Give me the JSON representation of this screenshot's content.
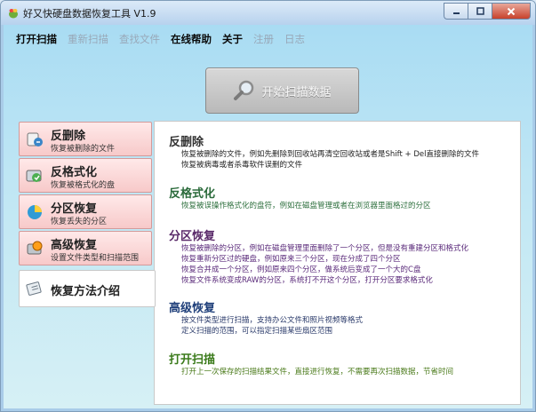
{
  "window": {
    "title": "好又快硬盘数据恢复工具 V1.9"
  },
  "menu": [
    {
      "label": "打开扫描",
      "state": "active"
    },
    {
      "label": "重新扫描",
      "state": "disabled"
    },
    {
      "label": "查找文件",
      "state": "disabled"
    },
    {
      "label": "在线帮助",
      "state": "active"
    },
    {
      "label": "关于",
      "state": "active"
    },
    {
      "label": "注册",
      "state": "disabled"
    },
    {
      "label": "日志",
      "state": "disabled"
    }
  ],
  "scan_button": {
    "label": "开始扫描数据",
    "icon": "magnifier-icon"
  },
  "sidebar": [
    {
      "title": "反删除",
      "subtitle": "恢复被删除的文件",
      "icon": "undelete-icon"
    },
    {
      "title": "反格式化",
      "subtitle": "恢复被格式化的盘",
      "icon": "unformat-icon"
    },
    {
      "title": "分区恢复",
      "subtitle": "恢复丢失的分区",
      "icon": "partition-icon"
    },
    {
      "title": "高级恢复",
      "subtitle": "设置文件类型和扫描范围",
      "icon": "advanced-icon"
    },
    {
      "title": "恢复方法介绍",
      "subtitle": "",
      "icon": "guide-icon",
      "selected": true
    }
  ],
  "content": {
    "sections": [
      {
        "title": "反删除",
        "lines": [
          "恢复被删除的文件，例如先删除到回收站再清空回收站或者是Shift + Del直接删除的文件",
          "恢复被病毒或者杀毒软件误删的文件"
        ]
      },
      {
        "title": "反格式化",
        "lines": [
          "恢复被误操作格式化的盘符，例如在磁盘管理或者在浏览器里面格过的分区"
        ]
      },
      {
        "title": "分区恢复",
        "lines": [
          "恢复被删除的分区，例如在磁盘管理里面删除了一个分区，但是没有重建分区和格式化",
          "恢复重新分区过的硬盘，例如原来三个分区，现在分成了四个分区",
          "恢复合并成一个分区，例如原来四个分区，做系统后变成了一个大的C盘",
          "恢复文件系统变成RAW的分区，系统打不开这个分区，打开分区要求格式化"
        ]
      },
      {
        "title": "高级恢复",
        "lines": [
          "按文件类型进行扫描，支持办公文件和照片视频等格式",
          "定义扫描的范围，可以指定扫描某些扇区范围"
        ]
      },
      {
        "title": "打开扫描",
        "lines": [
          "打开上一次保存的扫描结果文件，直接进行恢复，不需要再次扫描数据，节省时间"
        ]
      }
    ]
  }
}
